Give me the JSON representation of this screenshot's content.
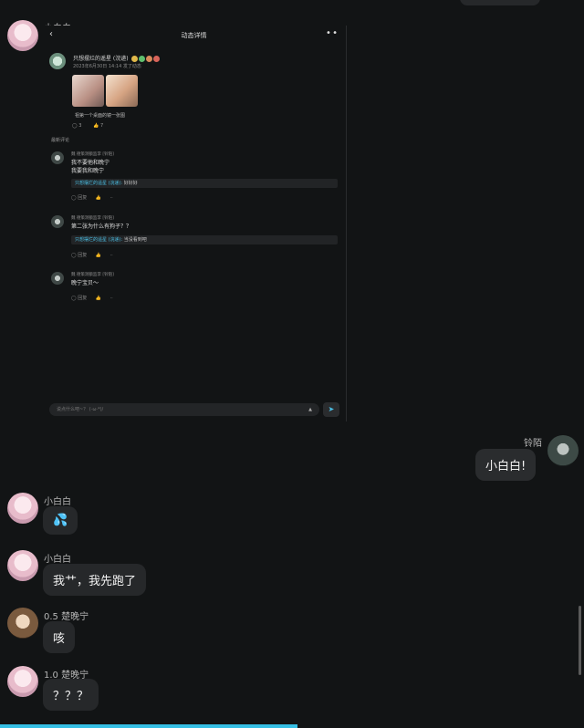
{
  "card": {
    "header_title": "动态详情",
    "post_author": "只想摆烂的遥星 (浣递)",
    "post_meta": "2023年6月30日 14:14   发了动态",
    "post_caption": "祖第一个桌面的镜一张图",
    "comment_count": "3",
    "like_count": "7",
    "section_label": "最新评论",
    "comments": [
      {
        "name": "魏 德策洞额监李 [铃陌]",
        "text_line1": "我不要他和晚宁",
        "text_line2": "我要我和晚宁",
        "reply_name": "只想摆烂的遥星 (浣递):",
        "reply_text": " 好好好",
        "actions": "回复"
      },
      {
        "name": "魏 德策洞额监李 [铃陌]",
        "text_line1": "第二张为什么有狗子？？",
        "reply_name": "只想摆烂的遥星 (浣递):",
        "reply_text": " 当没看到吧",
        "actions": "回复"
      },
      {
        "name": "魏 德策洞额监李 [铃陌]",
        "text_line1": "晚宁宝贝～",
        "actions": "回复"
      }
    ],
    "input_placeholder": "说点什么吧~？ (·ω·*)/"
  },
  "chat": [
    {
      "id": "m0",
      "side": "left",
      "name": "小白白",
      "avatar": "pink"
    },
    {
      "id": "m1",
      "side": "right",
      "name": "铃陌",
      "text": "小白白!",
      "avatar": "dark"
    },
    {
      "id": "m2",
      "side": "left",
      "name": "小白白",
      "text": "💦",
      "avatar": "pink"
    },
    {
      "id": "m3",
      "side": "left",
      "name": "小白白",
      "text": "我艹，我先跑了",
      "avatar": "pink"
    },
    {
      "id": "m4",
      "side": "left",
      "name": "0.5 楚晚宁",
      "text": "咳",
      "avatar": "brown"
    },
    {
      "id": "m5",
      "side": "left",
      "name": "1.0 楚晚宁",
      "text": "？？？",
      "avatar": "pink"
    }
  ],
  "colors": {
    "accent": "#36bfe4",
    "background": "#121415",
    "bubble": "#26282a"
  }
}
